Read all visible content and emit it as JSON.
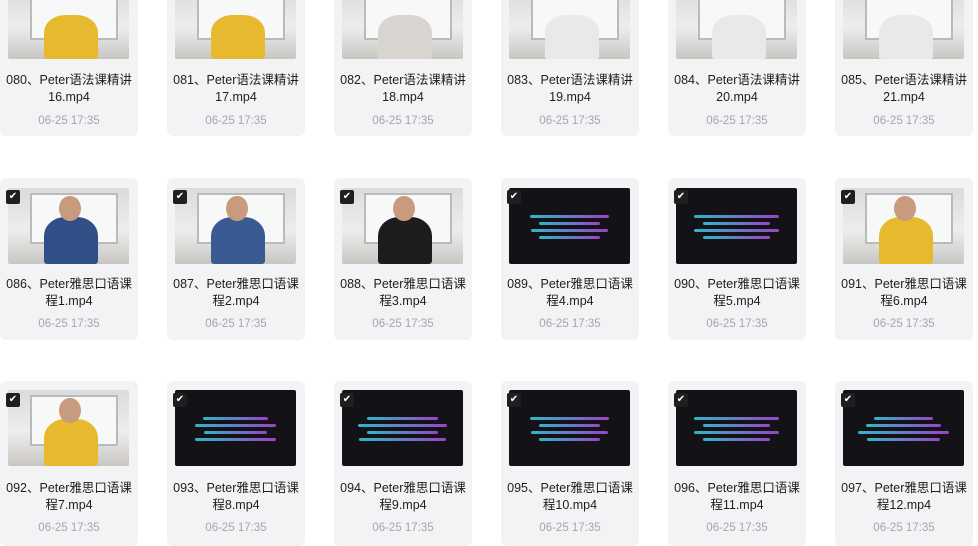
{
  "rows": [
    {
      "items": [
        {
          "name": "080、Peter语法课精讲16.mp4",
          "date": "06-25 17:35",
          "checked": false,
          "thumb": "person",
          "shirt": "#e7b92f"
        },
        {
          "name": "081、Peter语法课精讲17.mp4",
          "date": "06-25 17:35",
          "checked": false,
          "thumb": "person",
          "shirt": "#e7b92f"
        },
        {
          "name": "082、Peter语法课精讲18.mp4",
          "date": "06-25 17:35",
          "checked": false,
          "thumb": "person",
          "shirt": "#d8d4cf"
        },
        {
          "name": "083、Peter语法课精讲19.mp4",
          "date": "06-25 17:35",
          "checked": false,
          "thumb": "person",
          "shirt": "#e9e9ea"
        },
        {
          "name": "084、Peter语法课精讲20.mp4",
          "date": "06-25 17:35",
          "checked": false,
          "thumb": "person",
          "shirt": "#e9e9ea"
        },
        {
          "name": "085、Peter语法课精讲21.mp4",
          "date": "06-25 17:35",
          "checked": false,
          "thumb": "person",
          "shirt": "#e9e9ea"
        }
      ]
    },
    {
      "items": [
        {
          "name": "086、Peter雅思口语课程1.mp4",
          "date": "06-25 17:35",
          "checked": true,
          "thumb": "person",
          "shirt": "#2f4f86"
        },
        {
          "name": "087、Peter雅思口语课程2.mp4",
          "date": "06-25 17:35",
          "checked": true,
          "thumb": "person",
          "shirt": "#3a5a92"
        },
        {
          "name": "088、Peter雅思口语课程3.mp4",
          "date": "06-25 17:35",
          "checked": true,
          "thumb": "person",
          "shirt": "#1c1c1e"
        },
        {
          "name": "089、Peter雅思口语课程4.mp4",
          "date": "06-25 17:35",
          "checked": true,
          "thumb": "text"
        },
        {
          "name": "090、Peter雅思口语课程5.mp4",
          "date": "06-25 17:35",
          "checked": true,
          "thumb": "text"
        },
        {
          "name": "091、Peter雅思口语课程6.mp4",
          "date": "06-25 17:35",
          "checked": true,
          "thumb": "person",
          "shirt": "#e7b92f"
        }
      ]
    },
    {
      "items": [
        {
          "name": "092、Peter雅思口语课程7.mp4",
          "date": "06-25 17:35",
          "checked": true,
          "thumb": "person",
          "shirt": "#e7b92f"
        },
        {
          "name": "093、Peter雅思口语课程8.mp4",
          "date": "06-25 17:35",
          "checked": true,
          "thumb": "text"
        },
        {
          "name": "094、Peter雅思口语课程9.mp4",
          "date": "06-25 17:35",
          "checked": true,
          "thumb": "text"
        },
        {
          "name": "095、Peter雅思口语课程10.mp4",
          "date": "06-25 17:35",
          "checked": true,
          "thumb": "text"
        },
        {
          "name": "096、Peter雅思口语课程11.mp4",
          "date": "06-25 17:35",
          "checked": true,
          "thumb": "text"
        },
        {
          "name": "097、Peter雅思口语课程12.mp4",
          "date": "06-25 17:35",
          "checked": true,
          "thumb": "text"
        }
      ]
    }
  ],
  "checkmark_glyph": "✔"
}
